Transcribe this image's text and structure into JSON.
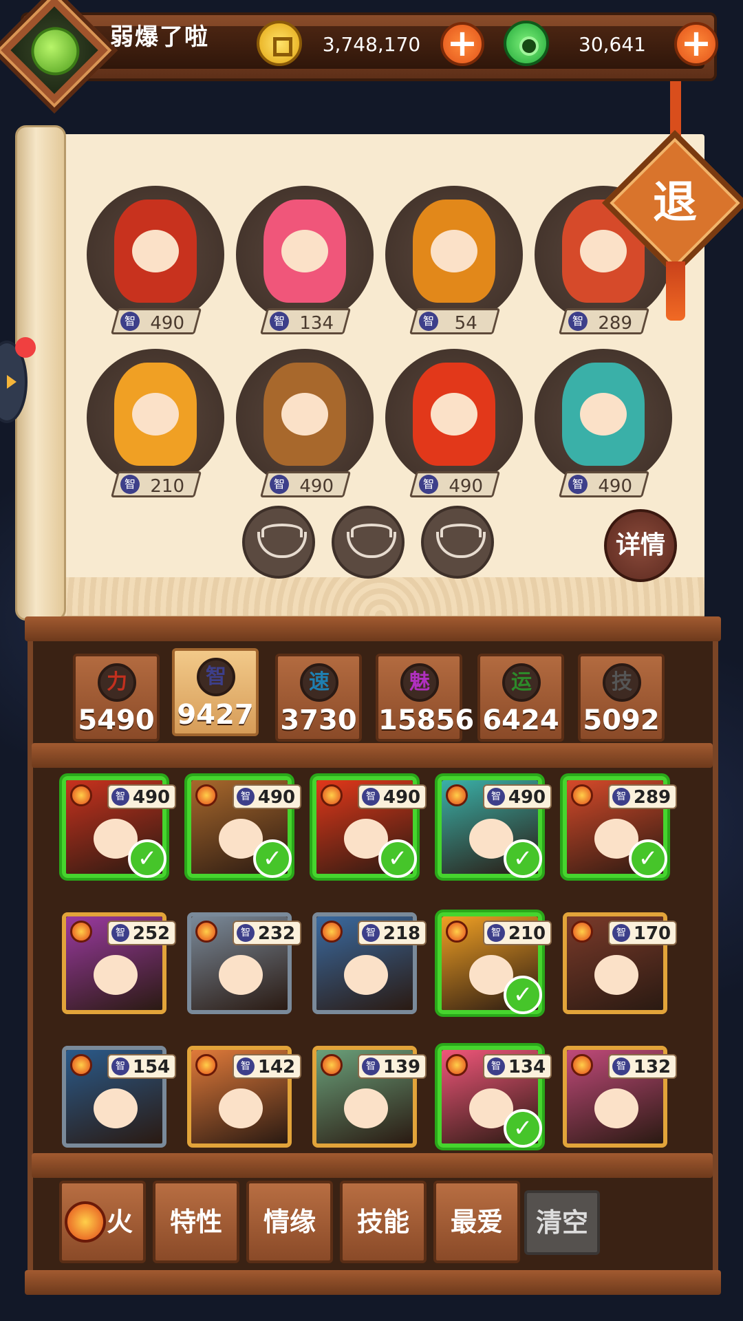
{
  "player": {
    "name": "弱爆了啦",
    "avatar_icon": "jade-dragon-icon"
  },
  "currency": {
    "coins": "3,748,170",
    "jade": "30,641"
  },
  "exit_label": "退",
  "detail_label": "详情",
  "stat_icon_label": "智",
  "team": [
    {
      "name": "bride",
      "value": "490",
      "color": "#c8321e"
    },
    {
      "name": "phoenix",
      "value": "134",
      "color": "#f0567a"
    },
    {
      "name": "zither",
      "value": "54",
      "color": "#e2881a"
    },
    {
      "name": "archer",
      "value": "289",
      "color": "#d64a2a"
    },
    {
      "name": "lantern",
      "value": "210",
      "color": "#f0a024"
    },
    {
      "name": "cart",
      "value": "490",
      "color": "#a8682c"
    },
    {
      "name": "flame",
      "value": "490",
      "color": "#e2381a"
    },
    {
      "name": "goggles",
      "value": "490",
      "color": "#3ab0a8"
    }
  ],
  "stats": [
    {
      "label": "力",
      "value": "5490",
      "color": "#c3301e"
    },
    {
      "label": "智",
      "value": "9427",
      "color": "#3d3f8a",
      "active": true
    },
    {
      "label": "速",
      "value": "3730",
      "color": "#1f7fb0"
    },
    {
      "label": "魅",
      "value": "15856",
      "color": "#b030c0"
    },
    {
      "label": "运",
      "value": "6424",
      "color": "#2d8a2a"
    },
    {
      "label": "技",
      "value": "5092",
      "color": "#555"
    }
  ],
  "roster": [
    {
      "value": "490",
      "selected": true,
      "color": "#c8321e"
    },
    {
      "value": "490",
      "selected": true,
      "color": "#a8682c"
    },
    {
      "value": "490",
      "selected": true,
      "color": "#e2381a"
    },
    {
      "value": "490",
      "selected": true,
      "color": "#3ab0a8"
    },
    {
      "value": "289",
      "selected": true,
      "color": "#d64a2a"
    },
    {
      "value": "252",
      "selected": false,
      "color": "#9a3aa0"
    },
    {
      "value": "232",
      "selected": false,
      "color": "#7a8a9a",
      "grey": true
    },
    {
      "value": "218",
      "selected": false,
      "color": "#3a6aa0",
      "grey": true
    },
    {
      "value": "210",
      "selected": true,
      "color": "#f0a024"
    },
    {
      "value": "170",
      "selected": false,
      "color": "#7a3a2a"
    },
    {
      "value": "154",
      "selected": false,
      "color": "#2a5a8a",
      "grey": true
    },
    {
      "value": "142",
      "selected": false,
      "color": "#e07a3a"
    },
    {
      "value": "139",
      "selected": false,
      "color": "#6aa07a"
    },
    {
      "value": "134",
      "selected": true,
      "color": "#f0567a"
    },
    {
      "value": "132",
      "selected": false,
      "color": "#c04a7a"
    }
  ],
  "filters": [
    {
      "label": "火",
      "icon": "fire-icon"
    },
    {
      "label": "特性"
    },
    {
      "label": "情缘"
    },
    {
      "label": "技能"
    },
    {
      "label": "最爱"
    },
    {
      "label": "清空",
      "clear": true
    }
  ]
}
